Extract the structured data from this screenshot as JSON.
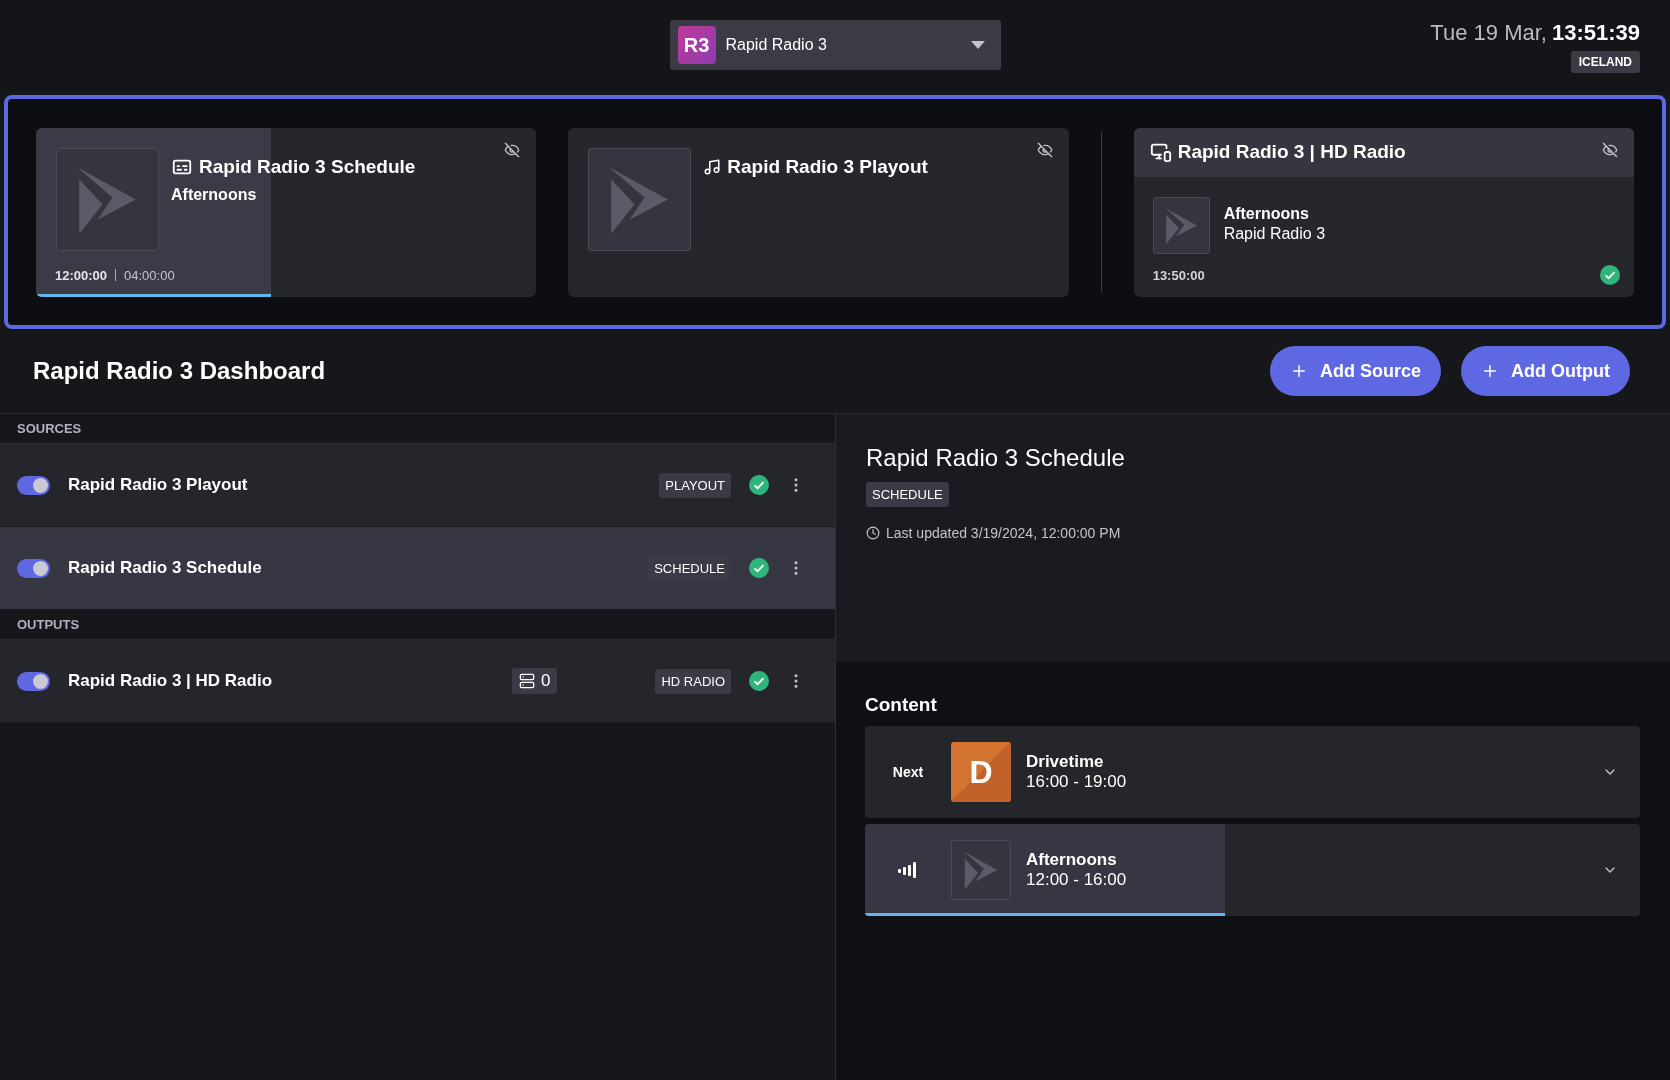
{
  "station_selector": {
    "badge": "R3",
    "name": "Rapid Radio 3"
  },
  "clock": {
    "date": "Tue 19 Mar,",
    "time": "13:51:39",
    "timezone": "ICELAND"
  },
  "now_playing": [
    {
      "kind": "schedule",
      "title": "Rapid Radio 3 Schedule",
      "subtitle": "Afternoons",
      "elapsed": "12:00:00",
      "duration": "04:00:00",
      "level": 0.47
    },
    {
      "kind": "playout",
      "title": "Rapid Radio 3 Playout"
    },
    {
      "kind": "output",
      "title": "Rapid Radio 3 | HD Radio",
      "show": "Afternoons",
      "station": "Rapid Radio 3",
      "time": "13:50:00",
      "ok": true
    }
  ],
  "dashboard": {
    "title": "Rapid Radio 3 Dashboard",
    "buttons": [
      "Add Source",
      "Add Output"
    ]
  },
  "sections": [
    {
      "heading": "SOURCES",
      "items": [
        {
          "name": "Rapid Radio 3 Playout",
          "tag": "PLAYOUT",
          "enabled": true,
          "selected": false,
          "ok": true
        },
        {
          "name": "Rapid Radio 3 Schedule",
          "tag": "SCHEDULE",
          "enabled": true,
          "selected": true,
          "ok": true
        }
      ]
    },
    {
      "heading": "OUTPUTS",
      "items": [
        {
          "name": "Rapid Radio 3 | HD Radio",
          "tag": "HD RADIO",
          "queue_count": "0",
          "enabled": true,
          "selected": false,
          "ok": true
        }
      ]
    }
  ],
  "details": {
    "title": "Rapid Radio 3 Schedule",
    "tag": "SCHEDULE",
    "updated": "Last updated 3/19/2024, 12:00:00 PM"
  },
  "content": {
    "heading": "Content",
    "items": [
      {
        "kind": "next",
        "label": "Next",
        "thumb_letter": "D",
        "title": "Drivetime",
        "time": "16:00 - 19:00"
      },
      {
        "kind": "live",
        "title": "Afternoons",
        "time": "12:00 - 16:00",
        "level": 0.465
      }
    ]
  }
}
